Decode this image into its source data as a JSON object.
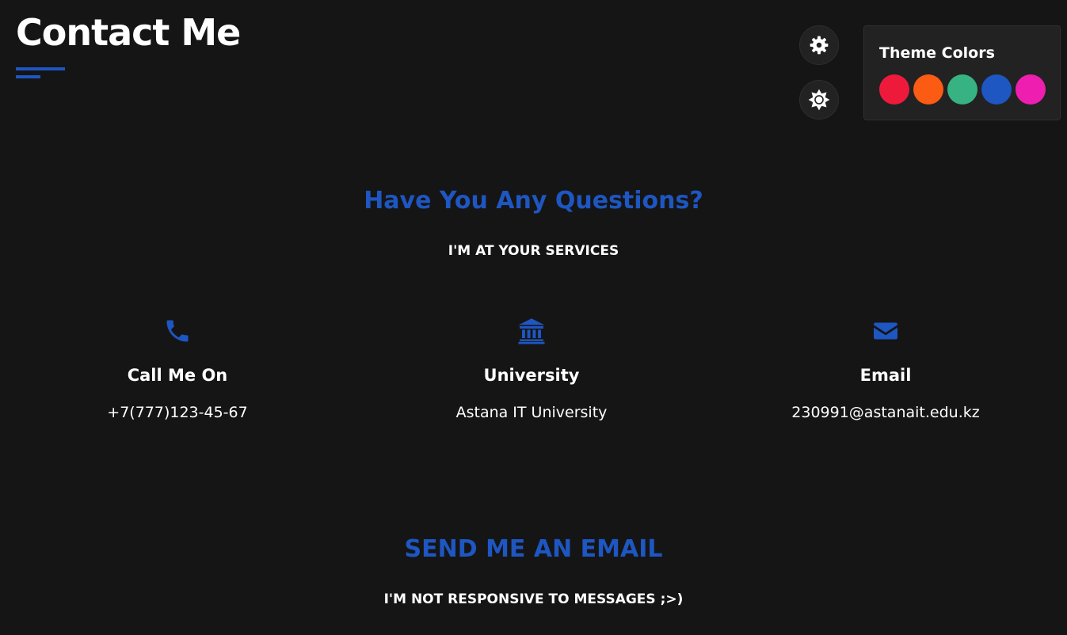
{
  "header": {
    "title": "Contact Me"
  },
  "controls": {
    "settings_icon": "gear-icon",
    "theme_toggle_icon": "sun-icon"
  },
  "theme_panel": {
    "title": "Theme Colors",
    "swatches": [
      "#ee1a3c",
      "#fb5b13",
      "#37b383",
      "#1e56c2",
      "#ee1fb0"
    ]
  },
  "questions": {
    "heading": "Have You Any Questions?",
    "subheading": "I'M AT YOUR SERVICES"
  },
  "contacts": [
    {
      "icon": "phone-icon",
      "title": "Call Me On",
      "value": "+7(777)123-45-67"
    },
    {
      "icon": "university-icon",
      "title": "University",
      "value": "Astana IT University"
    },
    {
      "icon": "envelope-icon",
      "title": "Email",
      "value": "230991@astanait.edu.kz"
    }
  ],
  "email_section": {
    "heading": "SEND ME AN EMAIL",
    "subheading": "I'M NOT RESPONSIVE TO MESSAGES ;>)"
  },
  "colors": {
    "accent": "#1e56c2",
    "background": "#151515",
    "panel": "#222222",
    "text": "#ffffff"
  }
}
